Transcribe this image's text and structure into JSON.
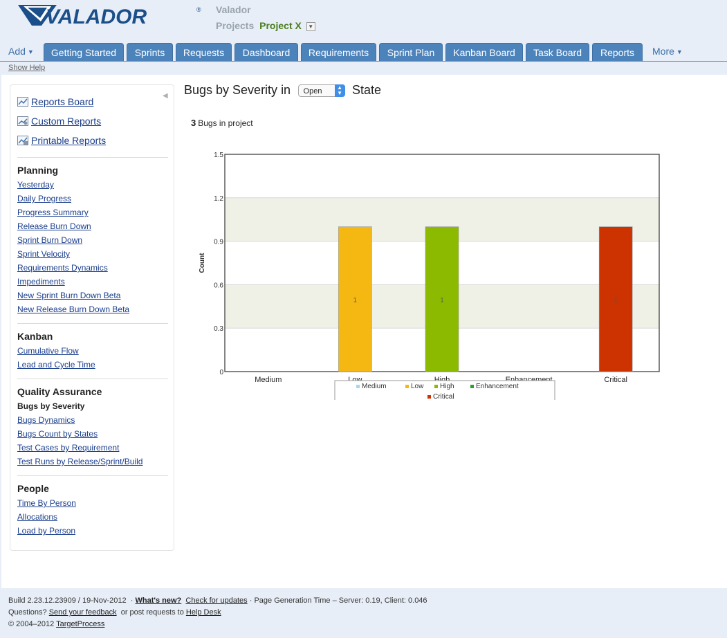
{
  "header": {
    "logo_text": "VALADOR",
    "app_name": "Valador",
    "projects_label": "Projects",
    "project_name": "Project X"
  },
  "tabs": {
    "add_label": "Add",
    "items": [
      "Getting Started",
      "Sprints",
      "Requests",
      "Dashboard",
      "Requirements",
      "Sprint Plan",
      "Kanban Board",
      "Task Board",
      "Reports"
    ],
    "more_label": "More",
    "active_color": "#4d83bb"
  },
  "show_help": "Show Help",
  "sidebar": {
    "top_links": [
      {
        "label": "Reports Board",
        "icon": "reports-board-icon"
      },
      {
        "label": "Custom Reports",
        "icon": "custom-reports-icon"
      },
      {
        "label": "Printable Reports",
        "icon": "printable-reports-icon"
      }
    ],
    "sections": [
      {
        "title": "Planning",
        "items": [
          "Yesterday",
          "Daily Progress",
          "Progress Summary",
          "Release Burn Down",
          "Sprint Burn Down",
          "Sprint Velocity",
          "Requirements Dynamics",
          "Impediments",
          "New Sprint Burn Down Beta",
          "New Release Burn Down Beta"
        ]
      },
      {
        "title": "Kanban",
        "items": [
          "Cumulative Flow",
          "Lead and Cycle Time"
        ]
      },
      {
        "title": "Quality Assurance",
        "items": [
          "Bugs by Severity",
          "Bugs Dynamics",
          "Bugs Count by States",
          "Test Cases by Requirement",
          "Test Runs by Release/Sprint/Build"
        ]
      },
      {
        "title": "People",
        "items": [
          "Time By Person",
          "Allocations",
          "Load by Person"
        ]
      }
    ],
    "current_item": "Bugs by Severity"
  },
  "report": {
    "title": "Bugs by Severity in",
    "state_value": "Open",
    "state_label": "State",
    "bugs_count": "3",
    "bugs_count_label": "Bugs in project"
  },
  "chart_data": {
    "type": "bar",
    "categories": [
      "Medium",
      "Low",
      "High",
      "Enhancement",
      "Critical"
    ],
    "values": [
      0,
      1,
      1,
      0,
      1
    ],
    "colors": [
      "#a8d8e8",
      "#f5b812",
      "#8bba00",
      "#2ca02c",
      "#cc3300"
    ],
    "ylabel": "Count",
    "xlabel": "",
    "ylim": [
      0,
      1.5
    ],
    "yticks": [
      "0",
      "0.3",
      "0.6",
      "0.9",
      "1.2",
      "1.5"
    ],
    "data_labels": [
      "",
      "1",
      "1",
      "",
      "1"
    ],
    "legend": [
      "Medium",
      "Low",
      "High",
      "Enhancement",
      "Critical"
    ],
    "legend_placement": "bottom",
    "grid": true
  },
  "footer": {
    "build": "Build 2.23.12.23909 / 19-Nov-2012",
    "whats_new": "What's new?",
    "check_updates": "Check for updates",
    "page_gen": "· Page Generation Time – Server: 0.19, Client: 0.046",
    "questions": "Questions?",
    "feedback": "Send your feedback",
    "or_post": "or post requests to",
    "help_desk": "Help Desk",
    "copyright": "© 2004–2012",
    "targetprocess": "TargetProcess"
  }
}
